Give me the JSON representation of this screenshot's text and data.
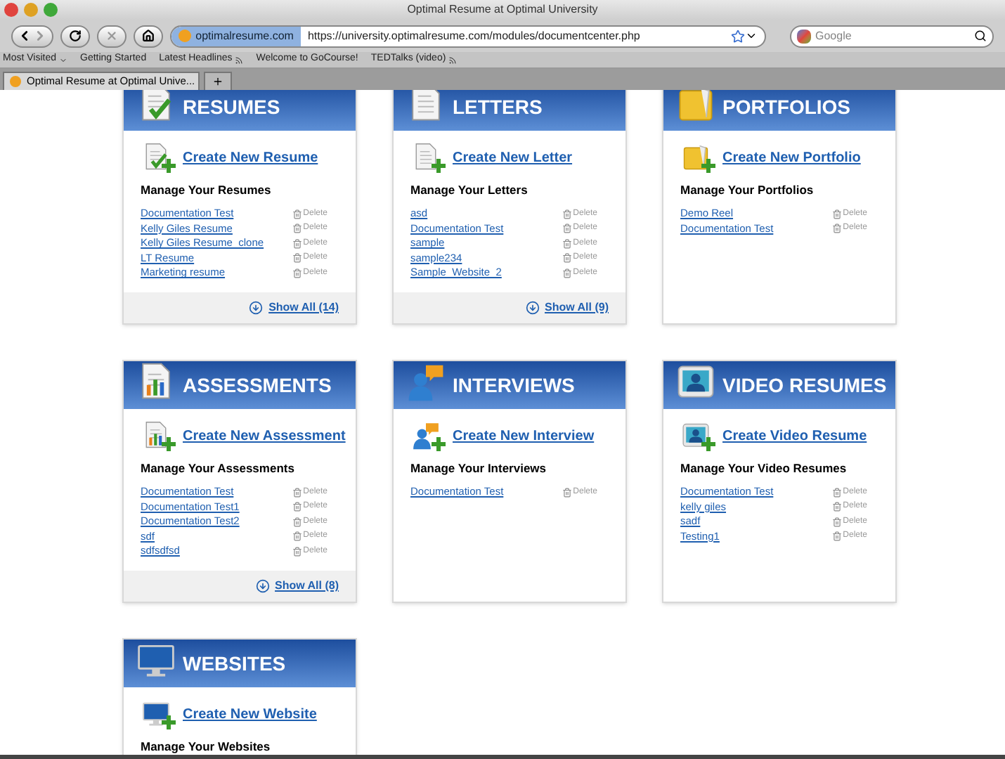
{
  "window": {
    "title": "Optimal Resume at Optimal University"
  },
  "toolbar": {
    "site_badge": "optimalresume.com",
    "url": "https://university.optimalresume.com/modules/documentcenter.php",
    "search": {
      "placeholder": "Google"
    }
  },
  "bookmarks": [
    {
      "label": "Most Visited",
      "kind": "menu"
    },
    {
      "label": "Getting Started",
      "kind": "link"
    },
    {
      "label": "Latest Headlines",
      "kind": "feed"
    },
    {
      "label": "Welcome to GoCourse!",
      "kind": "link"
    },
    {
      "label": "TEDTalks (video)",
      "kind": "feed"
    }
  ],
  "tabs": [
    {
      "label": "Optimal Resume at Optimal Unive...",
      "selected": true
    }
  ],
  "cards": [
    {
      "kind": "resumes",
      "title": "RESUMES",
      "create_label": "Create New Resume",
      "manage_heading": "Manage Your Resumes",
      "items": [
        {
          "name": "Documentation Test",
          "action": "Delete"
        },
        {
          "name": "Kelly Giles Resume",
          "action": "Delete"
        },
        {
          "name": "Kelly Giles Resume_clone",
          "action": "Delete"
        },
        {
          "name": "LT Resume",
          "action": "Delete"
        },
        {
          "name": "Marketing resume",
          "action": "Delete"
        }
      ],
      "show_all": "Show All (14)"
    },
    {
      "kind": "letters",
      "title": "LETTERS",
      "create_label": "Create New Letter",
      "manage_heading": "Manage Your Letters",
      "items": [
        {
          "name": "asd",
          "action": "Delete"
        },
        {
          "name": "Documentation Test",
          "action": "Delete"
        },
        {
          "name": "sample",
          "action": "Delete"
        },
        {
          "name": "sample234",
          "action": "Delete"
        },
        {
          "name": "Sample_Website_2",
          "action": "Delete"
        }
      ],
      "show_all": "Show All (9)"
    },
    {
      "kind": "portfolios",
      "title": "PORTFOLIOS",
      "create_label": "Create New Portfolio",
      "manage_heading": "Manage Your Portfolios",
      "items": [
        {
          "name": "Demo Reel",
          "action": "Delete"
        },
        {
          "name": "Documentation Test",
          "action": "Delete"
        }
      ]
    },
    {
      "kind": "assessments",
      "title": "ASSESSMENTS",
      "create_label": "Create New Assessment",
      "manage_heading": "Manage Your Assessments",
      "items": [
        {
          "name": "Documentation Test",
          "action": "Delete"
        },
        {
          "name": "Documentation Test1",
          "action": "Delete"
        },
        {
          "name": "Documentation Test2",
          "action": "Delete"
        },
        {
          "name": "sdf",
          "action": "Delete"
        },
        {
          "name": "sdfsdfsd",
          "action": "Delete"
        }
      ],
      "show_all": "Show All (8)"
    },
    {
      "kind": "interviews",
      "title": "INTERVIEWS",
      "create_label": "Create New Interview",
      "manage_heading": "Manage Your Interviews",
      "items": [
        {
          "name": "Documentation Test",
          "action": "Delete"
        }
      ]
    },
    {
      "kind": "video",
      "title": "VIDEO RESUMES",
      "create_label": "Create Video Resume",
      "manage_heading": "Manage Your Video Resumes",
      "items": [
        {
          "name": "Documentation Test",
          "action": "Delete"
        },
        {
          "name": "kelly giles",
          "action": "Delete"
        },
        {
          "name": "sadf",
          "action": "Delete"
        },
        {
          "name": "Testing1",
          "action": "Delete"
        }
      ]
    },
    {
      "kind": "websites",
      "title": "WEBSITES",
      "create_label": "Create New Website",
      "manage_heading": "Manage Your Websites"
    }
  ]
}
